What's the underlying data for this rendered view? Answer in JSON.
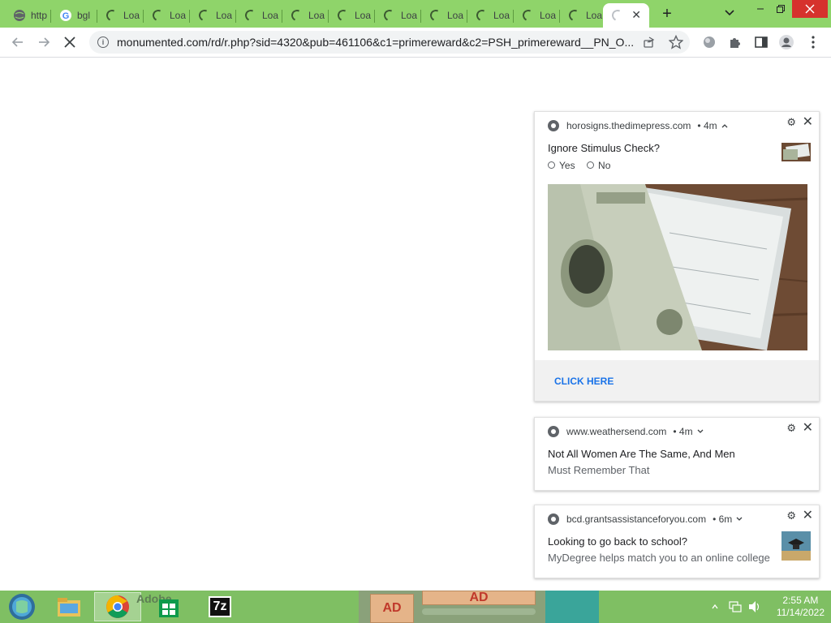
{
  "tabs": [
    {
      "title": "http",
      "icon": "globe-icon"
    },
    {
      "title": "bgl",
      "icon": "google-icon"
    },
    {
      "title": "Loa",
      "icon": "loading-icon"
    },
    {
      "title": "Loa",
      "icon": "loading-icon"
    },
    {
      "title": "Loa",
      "icon": "loading-icon"
    },
    {
      "title": "Loa",
      "icon": "loading-icon"
    },
    {
      "title": "Loa",
      "icon": "loading-icon"
    },
    {
      "title": "Loa",
      "icon": "loading-icon"
    },
    {
      "title": "Loa",
      "icon": "loading-icon"
    },
    {
      "title": "Loa",
      "icon": "loading-icon"
    },
    {
      "title": "Loa",
      "icon": "loading-icon"
    },
    {
      "title": "Loa",
      "icon": "loading-icon"
    },
    {
      "title": "Loa",
      "icon": "loading-icon"
    }
  ],
  "active_tab": {
    "icon": "loading-icon",
    "close": "✕"
  },
  "new_tab_label": "+",
  "toolbar": {
    "url": "monumented.com/rd/r.php?sid=4320&pub=461106&c1=primereward&c2=PSH_primereward__PN_O..."
  },
  "notifications": [
    {
      "source": "horosigns.thedimepress.com",
      "age": "• 4m",
      "title": "Ignore Stimulus Check?",
      "options": [
        "Yes",
        "No"
      ],
      "cta": "CLICK HERE"
    },
    {
      "source": "www.weathersend.com",
      "age": "• 4m",
      "title": "Not All Women Are The Same, And Men",
      "body": "Must Remember That"
    },
    {
      "source": "bcd.grantsassistanceforyou.com",
      "age": "• 6m",
      "title": "Looking to go back to school?",
      "body": "MyDegree helps match you to an online college"
    }
  ],
  "taskbar": {
    "time": "2:55 AM",
    "date": "11/14/2022",
    "apps": [
      "Adobe",
      "AD",
      "AD"
    ],
    "sevenzip_label": "7z"
  },
  "colors": {
    "tabstrip": "#8fd46a",
    "taskbar": "#7fbf63",
    "link": "#1a73e8"
  }
}
